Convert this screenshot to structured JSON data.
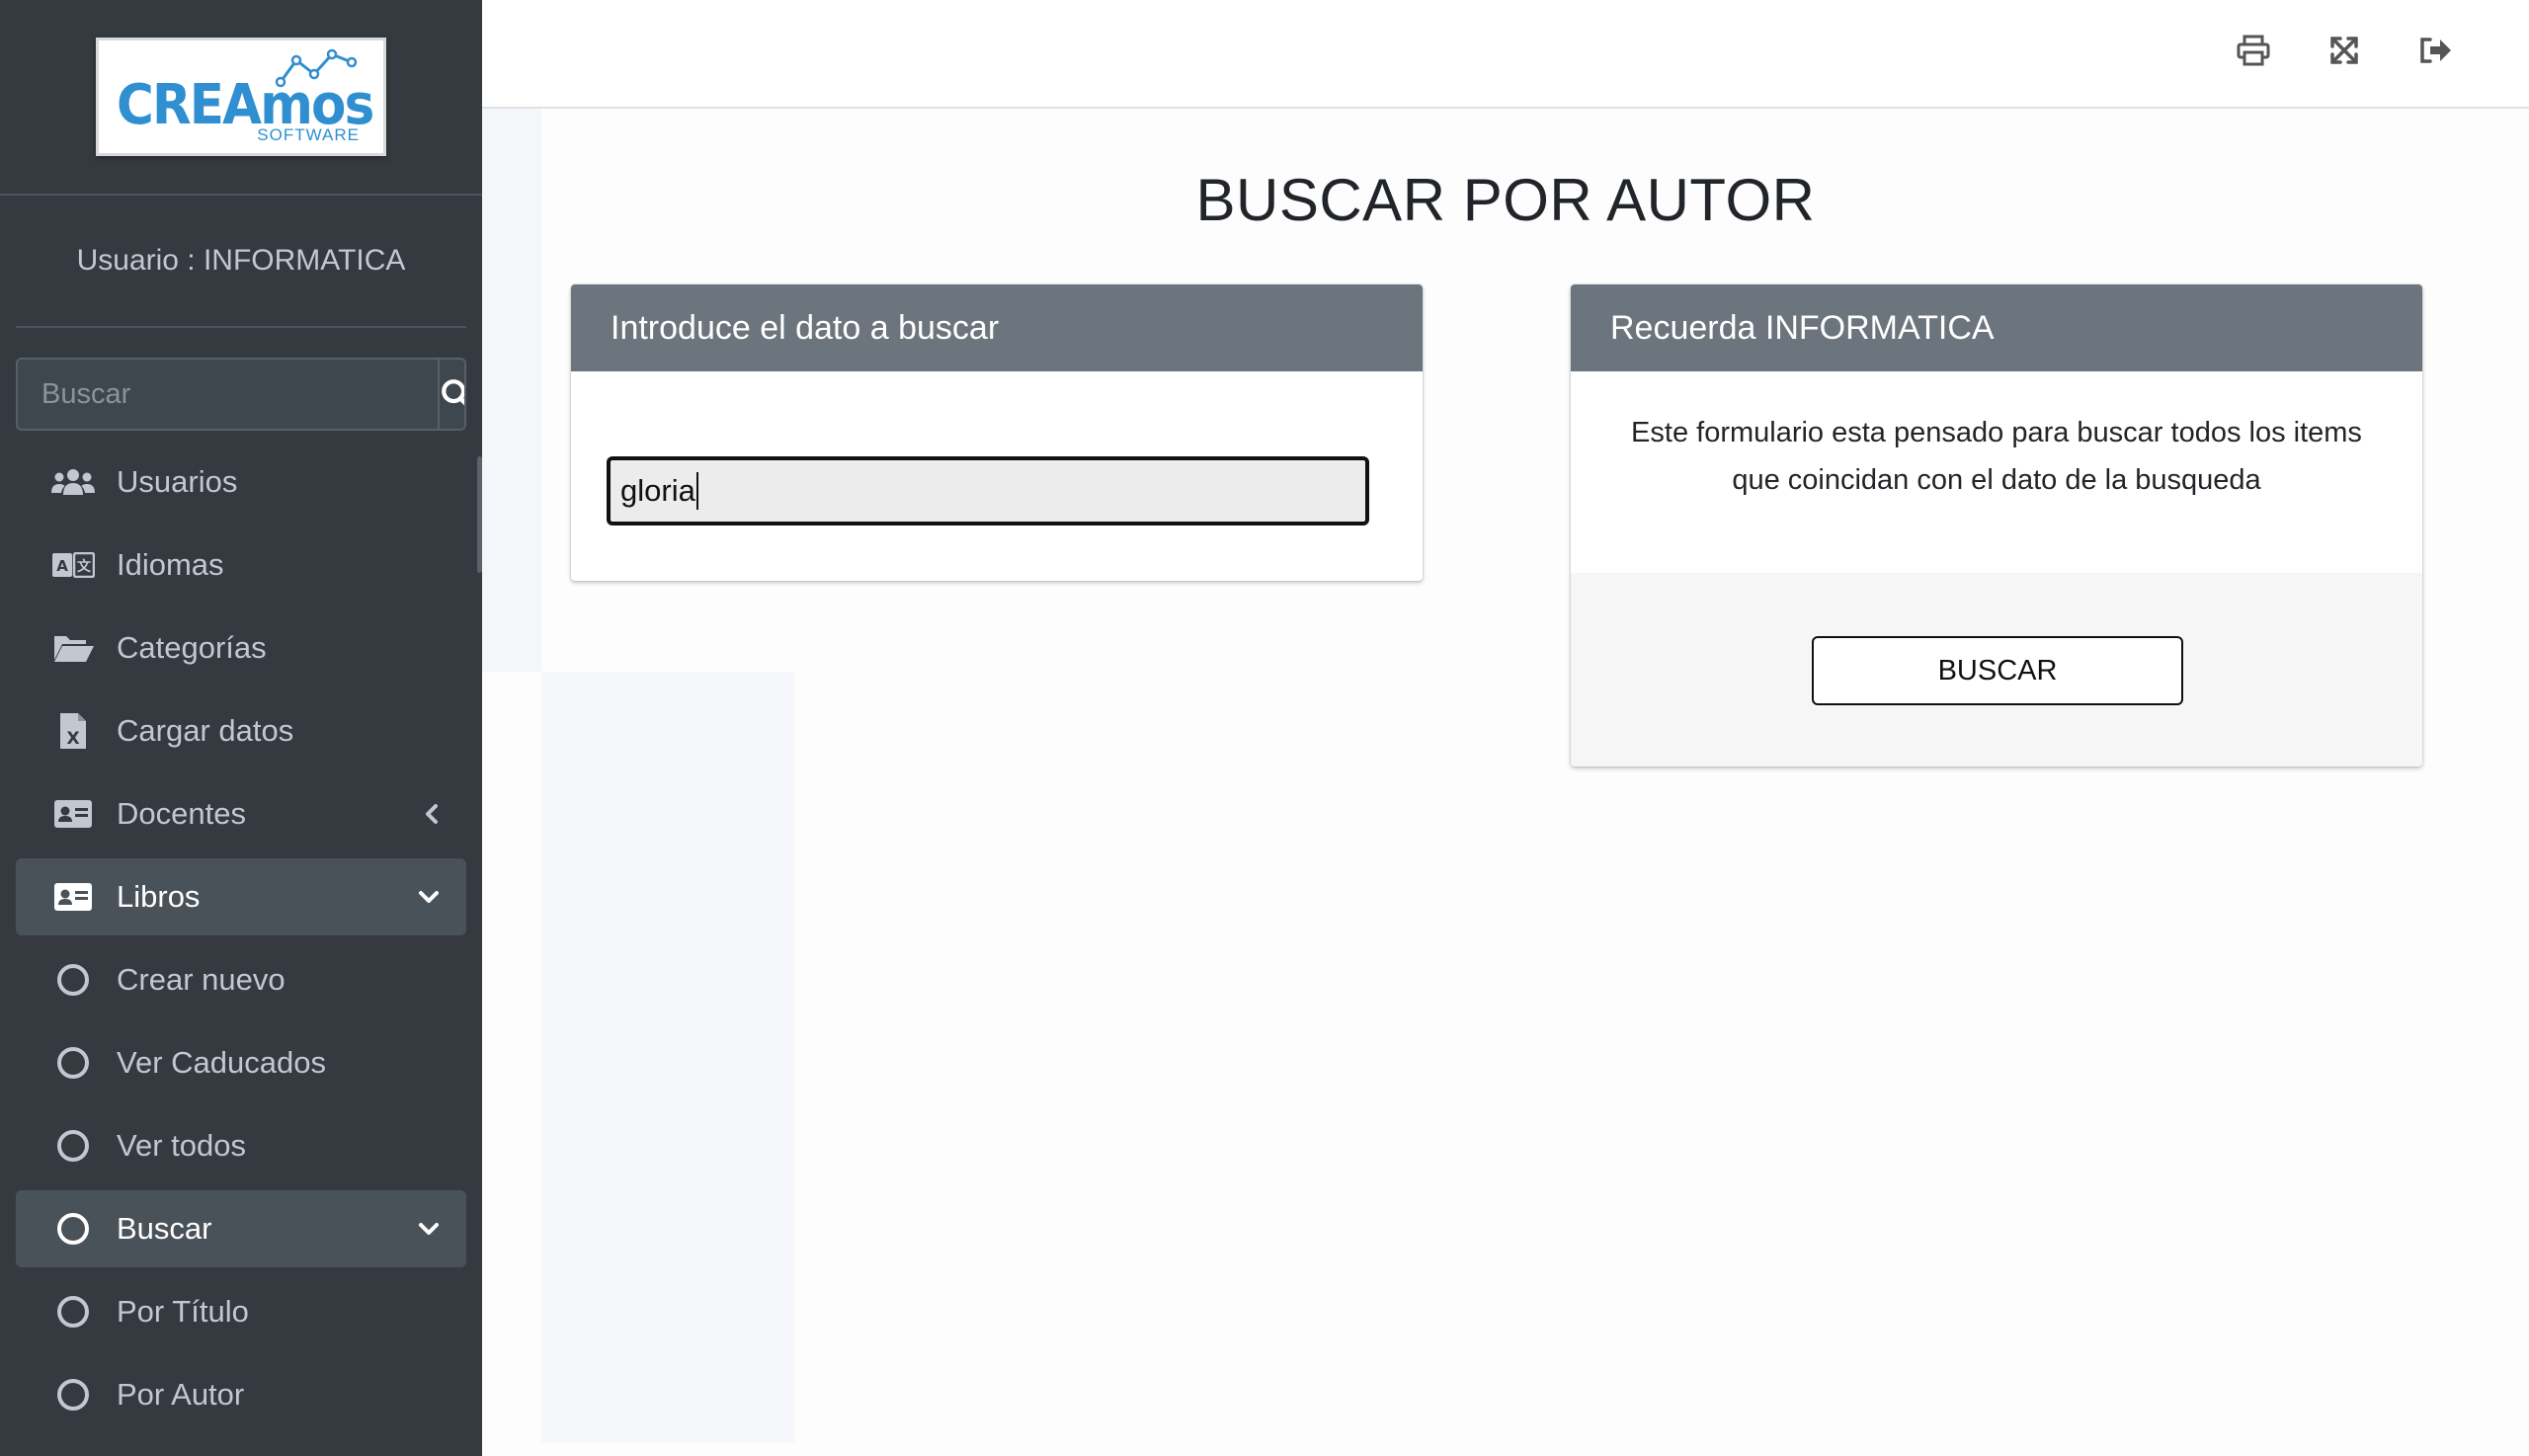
{
  "sidebar": {
    "logo": {
      "name": "CREAmos",
      "sub": "SOFTWARE"
    },
    "user_label": "Usuario : INFORMATICA",
    "search": {
      "placeholder": "Buscar"
    },
    "items": [
      {
        "label": "Usuarios",
        "icon": "users-icon"
      },
      {
        "label": "Idiomas",
        "icon": "language-icon"
      },
      {
        "label": "Categorías",
        "icon": "folder-open-icon"
      },
      {
        "label": "Cargar datos",
        "icon": "file-excel-icon"
      },
      {
        "label": "Docentes",
        "icon": "id-card-icon",
        "chevron": "left"
      },
      {
        "label": "Libros",
        "icon": "id-card-icon",
        "chevron": "down",
        "active": true
      },
      {
        "label": "Crear nuevo",
        "icon": "circle-icon"
      },
      {
        "label": "Ver Caducados",
        "icon": "circle-icon"
      },
      {
        "label": "Ver todos",
        "icon": "circle-icon"
      },
      {
        "label": "Buscar",
        "icon": "circle-icon",
        "chevron": "down",
        "active": true
      },
      {
        "label": "Por Título",
        "icon": "circle-icon"
      },
      {
        "label": "Por Autor",
        "icon": "circle-icon"
      }
    ]
  },
  "topbar": {
    "icons": [
      "print-icon",
      "fullscreen-icon",
      "logout-icon"
    ]
  },
  "page": {
    "title": "BUSCAR POR AUTOR",
    "search_card": {
      "header": "Introduce el dato a buscar",
      "input_value": "gloria"
    },
    "info_card": {
      "header": "Recuerda INFORMATICA",
      "text": "Este formulario esta pensado para buscar todos los items que coincidan con el dato de la busqueda",
      "button_label": "BUSCAR"
    }
  },
  "colors": {
    "sidebar_bg": "#343a40",
    "sidebar_text": "#c2c7d0",
    "card_header_bg": "#6c757d",
    "logo_blue": "#2f8fd0"
  }
}
